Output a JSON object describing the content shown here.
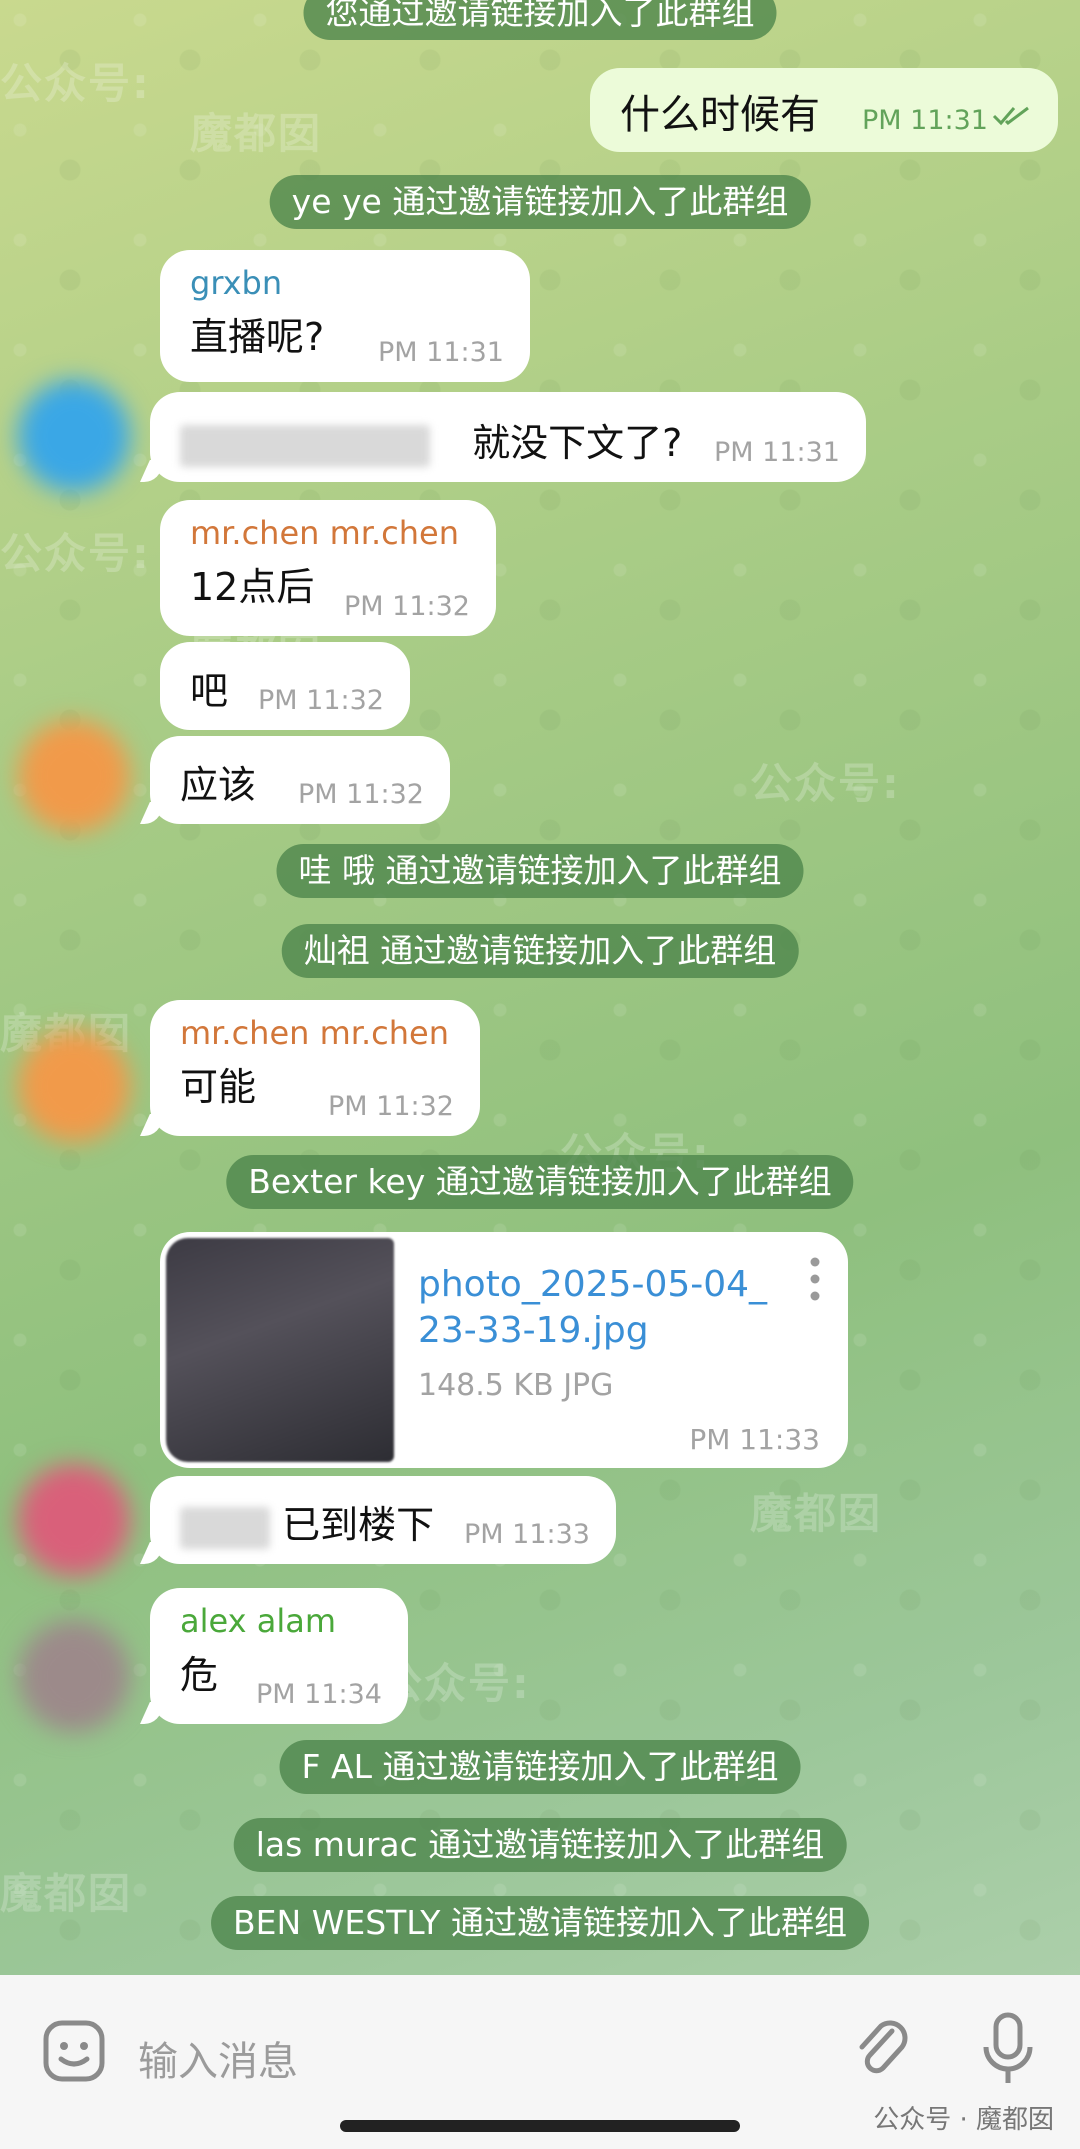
{
  "system_messages": [
    {
      "text": "您通过邀请链接加入了此群组"
    },
    {
      "text": "ye ye 通过邀请链接加入了此群组"
    },
    {
      "text": "哇 哦 通过邀请链接加入了此群组"
    },
    {
      "text": "灿祖 通过邀请链接加入了此群组"
    },
    {
      "text": "Bexter key 通过邀请链接加入了此群组"
    },
    {
      "text": "F AL 通过邀请链接加入了此群组"
    },
    {
      "text": "las murac 通过邀请链接加入了此群组"
    },
    {
      "text": "BEN WESTLY 通过邀请链接加入了此群组"
    }
  ],
  "messages": [
    {
      "text": "什么时候有",
      "time": "PM 11:31",
      "status": "read"
    },
    {
      "sender": "grxbn",
      "sender_color": "#3a8fb7",
      "text": "直播呢?",
      "time": "PM 11:31"
    },
    {
      "text": "就没下文了?",
      "time": "PM 11:31"
    },
    {
      "sender": "mr.chen mr.chen",
      "sender_color": "#d2773a",
      "text": "12点后",
      "time": "PM 11:32"
    },
    {
      "text": "吧",
      "time": "PM 11:32"
    },
    {
      "text": "应该",
      "time": "PM 11:32"
    },
    {
      "sender": "mr.chen mr.chen",
      "sender_color": "#d2773a",
      "text": "可能",
      "time": "PM 11:32"
    },
    {
      "text": "已到楼下",
      "time": "PM 11:33"
    },
    {
      "sender": "alex alam",
      "sender_color": "#4aa83a",
      "text": "危",
      "time": "PM 11:34"
    }
  ],
  "file": {
    "name": "photo_2025-05-04_23-33-19.jpg",
    "name_line1": "photo_2025-05-04_",
    "name_line2": "23-33-19.jpg",
    "meta": "148.5 KB JPG",
    "time": "PM 11:33",
    "link_color": "#3a8fd6"
  },
  "input": {
    "placeholder": "输入消息"
  },
  "watermark": {
    "account_tag": "公众号:",
    "name": "魔都囡",
    "footer": "公众号 · 魔都囡"
  },
  "icons": {
    "read_receipt": "double-check-icon",
    "emoji": "sticker-icon",
    "attach": "paperclip-icon",
    "mic": "microphone-icon",
    "menu": "more-vertical-icon"
  }
}
